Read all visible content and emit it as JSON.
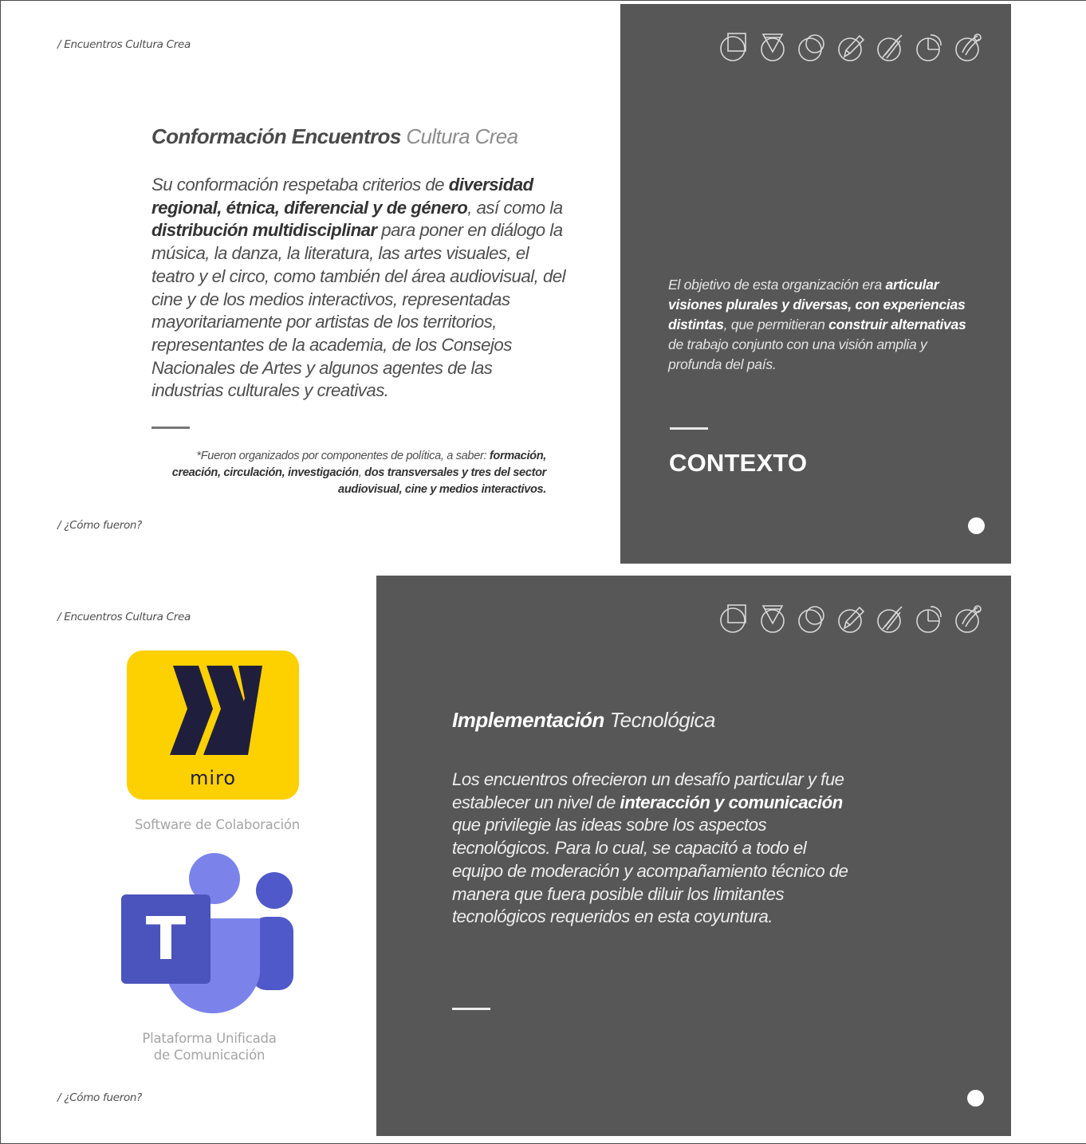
{
  "slide1": {
    "breadcrumb_top": "/ Encuentros Cultura Crea",
    "breadcrumb_bottom": "/ ¿Cómo fueron?",
    "title_bold": "Conformación Encuentros",
    "title_soft": "Cultura Crea",
    "body": {
      "p1": "Su conformación respetaba criterios de ",
      "b1": "diversidad regional, étnica, diferencial y de género",
      "p2": ", así como la ",
      "b2": "distribución multidisciplinar",
      "p3": " para poner en diálogo la música, la danza, la literatura, las artes visuales, el teatro y el circo, como también del área audiovisual, del cine y de los medios interactivos, representadas mayoritariamente por artistas de los territorios, representantes de la academia, de los Consejos Nacionales de Artes y algunos agentes de las industrias culturales y creativas."
    },
    "note": {
      "p1": "*Fueron organizados por componentes de política, a saber: ",
      "b1": "formación, creación, circulación, investigación",
      "p2": ", ",
      "b2": "dos transversales y tres del sector audiovisual, cine y medios interactivos."
    },
    "quote": {
      "p1": "El objetivo de esta organización era ",
      "b1": "articular visiones plurales y diversas, con experiencias distintas",
      "p2": ", que permitieran ",
      "b2": "construir alternativas",
      "p3": " de trabajo conjunto con una visión amplia y profunda del país."
    },
    "heading": "CONTEXTO"
  },
  "slide2": {
    "breadcrumb_top": "/ Encuentros Cultura Crea",
    "breadcrumb_bottom": "/ ¿Cómo fueron?",
    "miro_word": "miro",
    "miro_caption": "Software de Colaboración",
    "teams_letter": "T",
    "teams_caption_1": "Plataforma Unificada",
    "teams_caption_2": "de Comunicación",
    "title_bold": "Implementación",
    "title_soft": "Tecnológica",
    "body": {
      "p1": "Los encuentros ofrecieron un desafío particular y fue establecer un nivel de ",
      "b1": "interacción y comunicación",
      "p2": " que privilegie las ideas sobre los aspectos tecnológicos. Para lo cual, se capacitó a todo el equipo de moderación y acompañamiento técnico de manera que fuera posible diluir los limitantes tecnológicos requeridos en esta coyuntura."
    }
  },
  "icons": [
    "square-circle-icon",
    "triangle-circle-icon",
    "circle-overlap-icon",
    "pencil-circle-icon",
    "brush-circle-icon",
    "pie-circle-icon",
    "spiral-circle-icon"
  ],
  "colors": {
    "dark_panel": "#575757",
    "miro_yellow": "#fdd000",
    "miro_ink": "#1f1f3d",
    "teams_purple": "#5059c9",
    "teams_light": "#7b83eb"
  }
}
